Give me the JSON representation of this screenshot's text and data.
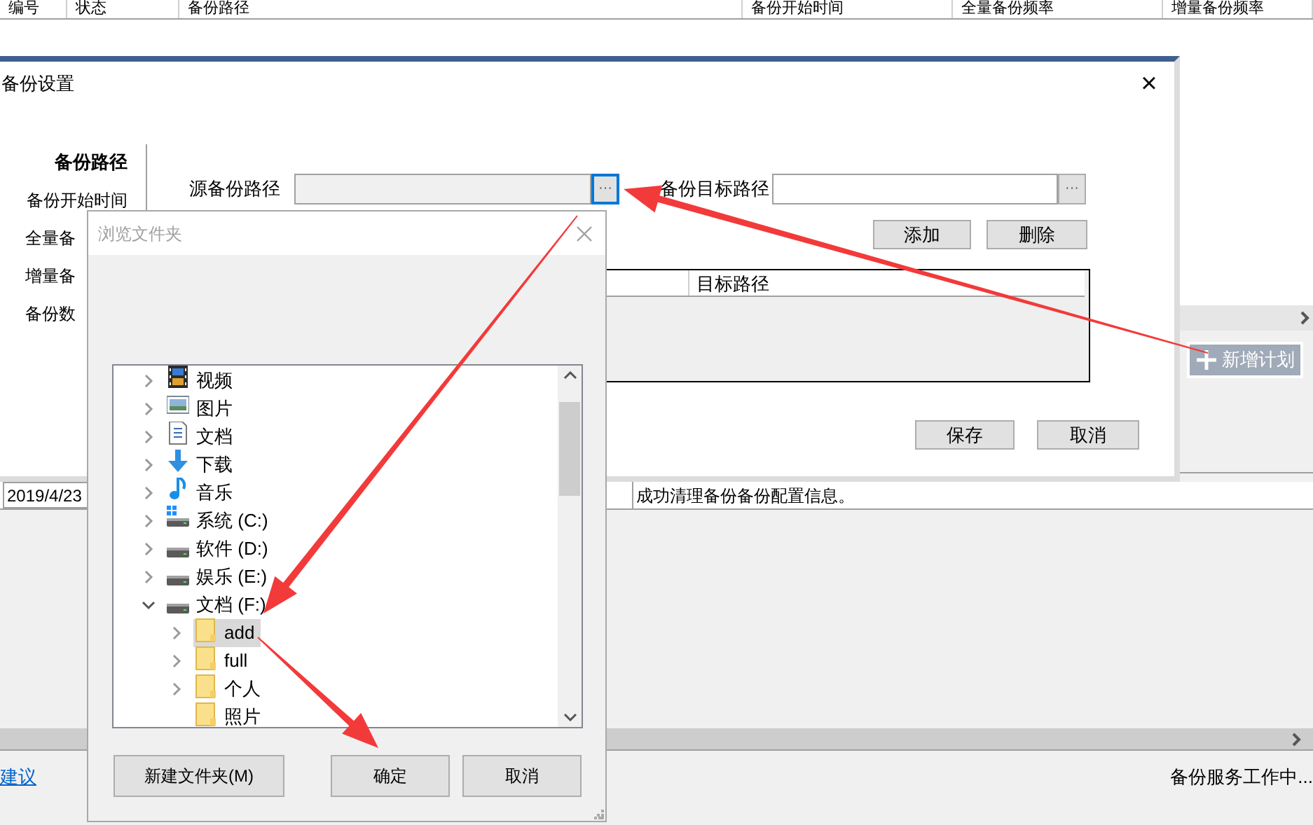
{
  "main_window": {
    "table_columns": [
      "编号",
      "状态",
      "备份路径",
      "备份开始时间",
      "全量备份频率",
      "增量备份频率"
    ],
    "add_plan_button": "新增计划",
    "log_rows": [
      {
        "date": "2019/4/23",
        "message": "成功清理备份备份配置信息。"
      }
    ],
    "link": "建议",
    "status": "备份服务工作中..."
  },
  "settings_dialog": {
    "title": "备份设置",
    "close": "×",
    "nav": [
      {
        "label": "备份路径",
        "selected": true
      },
      {
        "label": "备份开始时间",
        "selected": false
      },
      {
        "label": "全量备",
        "selected": false
      },
      {
        "label": "增量备",
        "selected": false
      },
      {
        "label": "备份数",
        "selected": false
      }
    ],
    "source_label": "源备份路径",
    "source_browse": {
      "label": "···",
      "focused": true
    },
    "target_label": "备份目标路径",
    "target_browse": {
      "label": "···",
      "focused": false
    },
    "add_button": "添加",
    "delete_button": "删除",
    "path_table_columns": [
      "目标路径"
    ],
    "save_button": "保存",
    "cancel_button": "取消"
  },
  "folder_dialog": {
    "title": "浏览文件夹",
    "tree": [
      {
        "label": "视频",
        "kind": "video",
        "expanded": false
      },
      {
        "label": "图片",
        "kind": "picture",
        "expanded": false
      },
      {
        "label": "文档",
        "kind": "document",
        "expanded": false
      },
      {
        "label": "下载",
        "kind": "download",
        "expanded": false
      },
      {
        "label": "音乐",
        "kind": "music",
        "expanded": false
      },
      {
        "label": "系统 (C:)",
        "kind": "system_drive",
        "expanded": false
      },
      {
        "label": "软件 (D:)",
        "kind": "drive",
        "expanded": false
      },
      {
        "label": "娱乐 (E:)",
        "kind": "drive",
        "expanded": false
      },
      {
        "label": "文档 (F:)",
        "kind": "drive",
        "expanded": true,
        "children": [
          {
            "label": "add",
            "kind": "folder",
            "has_children": true,
            "selected": true
          },
          {
            "label": "full",
            "kind": "folder",
            "has_children": true,
            "selected": false
          },
          {
            "label": "个人",
            "kind": "folder",
            "has_children": true,
            "selected": false
          },
          {
            "label": "照片",
            "kind": "folder",
            "has_children": false,
            "selected": false
          }
        ]
      }
    ],
    "new_folder_button": "新建文件夹(M)",
    "ok_button": "确定",
    "cancel_button": "取消"
  }
}
